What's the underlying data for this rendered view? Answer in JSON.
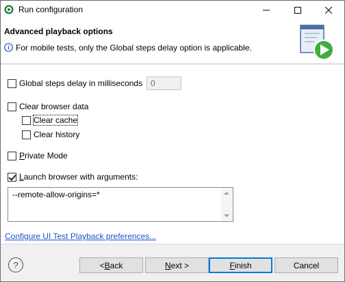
{
  "window": {
    "title": "Run configuration"
  },
  "banner": {
    "title": "Advanced playback options",
    "message": "For mobile tests, only the Global steps delay option is applicable."
  },
  "options": {
    "global_delay": {
      "label": "Global steps delay in milliseconds",
      "checked": false,
      "value": "0"
    },
    "clear_browser_data": {
      "label": "Clear browser data",
      "checked": false
    },
    "clear_cache": {
      "label": "Clear cache",
      "checked": false
    },
    "clear_history": {
      "label": "Clear history",
      "checked": false
    },
    "private_mode": {
      "label_mnemonic": "P",
      "label_rest": "rivate Mode",
      "checked": false
    },
    "launch_with_args": {
      "label_mnemonic": "L",
      "label_rest": "aunch browser with arguments:",
      "checked": true
    },
    "arguments_value": "--remote-allow-origins=*"
  },
  "link": {
    "label": "Configure UI Test Playback preferences..."
  },
  "footer": {
    "help": "?",
    "back_pre": "< ",
    "back_mnemonic": "B",
    "back_rest": "ack",
    "next_mnemonic": "N",
    "next_rest": "ext >",
    "finish_mnemonic": "F",
    "finish_rest": "inish",
    "cancel": "Cancel"
  },
  "icons": {
    "app": "run-configuration-icon",
    "info": "info-icon",
    "wizard": "playback-wizard-graphic"
  },
  "colors": {
    "link": "#1a55c8",
    "default_button_border": "#0078d7",
    "wizard_play": "#3fae3f"
  }
}
